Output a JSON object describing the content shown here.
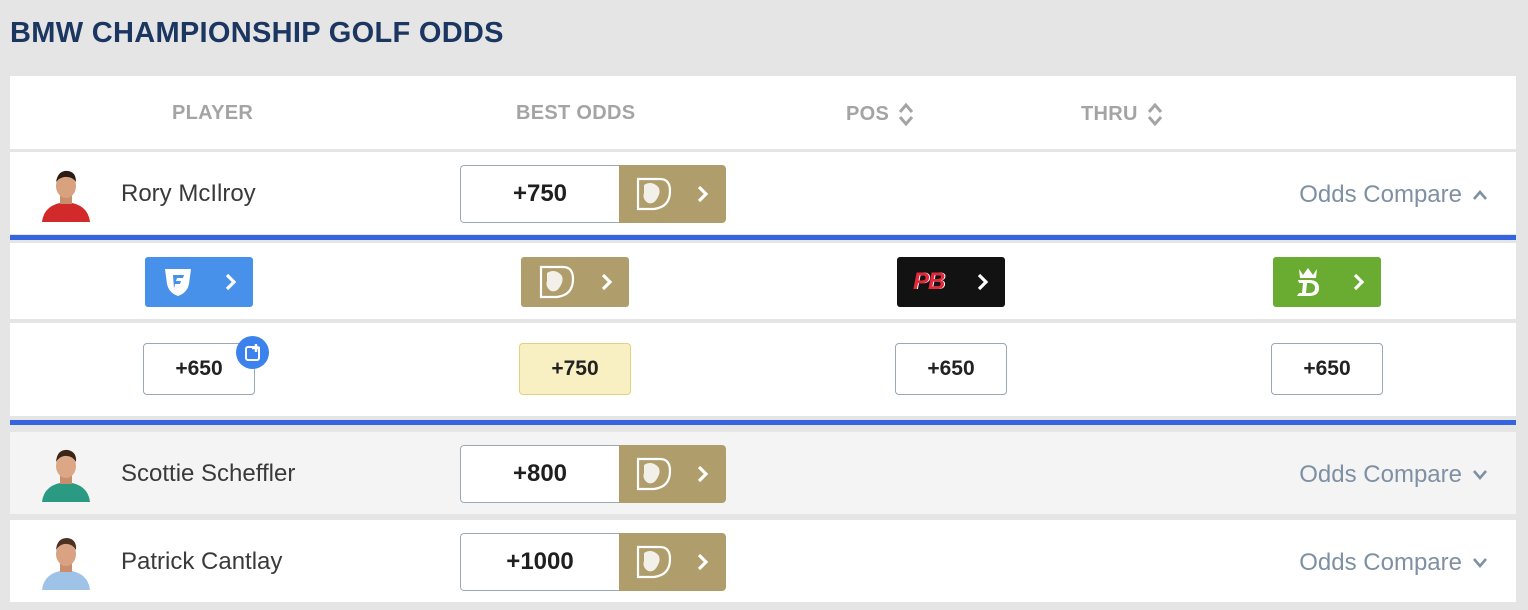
{
  "title": "BMW CHAMPIONSHIP GOLF ODDS",
  "columns": {
    "player": "PLAYER",
    "best_odds": "BEST ODDS",
    "pos": "POS",
    "thru": "THRU"
  },
  "players": [
    {
      "name": "Rory McIlroy",
      "best_odds": "+750",
      "book_icon": "betmgm-lion-icon",
      "compare_label": "Odds Compare",
      "compare_icon": "chevron-up-icon",
      "expanded": true,
      "jersey_color": "#d22a2a"
    },
    {
      "name": "Scottie Scheffler",
      "best_odds": "+800",
      "book_icon": "betmgm-lion-icon",
      "compare_label": "Odds Compare",
      "compare_icon": "chevron-down-icon",
      "expanded": false,
      "jersey_color": "#2a9b82"
    },
    {
      "name": "Patrick Cantlay",
      "best_odds": "+1000",
      "book_icon": "betmgm-lion-icon",
      "compare_label": "Odds Compare",
      "compare_icon": "chevron-down-icon",
      "expanded": false,
      "jersey_color": "#9fc3e6"
    }
  ],
  "compare": {
    "books": [
      {
        "name": "fanduel",
        "icon": "fanduel-shield-icon",
        "color": "#4891ea"
      },
      {
        "name": "betmgm",
        "icon": "betmgm-lion-icon",
        "color": "#b09d6c"
      },
      {
        "name": "pointsbet",
        "logo_text": "PB",
        "icon": "pointsbet-logo-icon",
        "color": "#121212"
      },
      {
        "name": "draftkings",
        "icon": "draftkings-crown-icon",
        "color": "#6aac32"
      }
    ],
    "odds": [
      "+650",
      "+750",
      "+650",
      "+650"
    ],
    "best_index": 1,
    "bet_slip_icon": "add-to-betslip-icon"
  },
  "colors": {
    "title": "#1b3660",
    "accent_bar": "#3564e0",
    "best_highlight": "#f8f0c2",
    "compare_text": "#7f90a3"
  }
}
